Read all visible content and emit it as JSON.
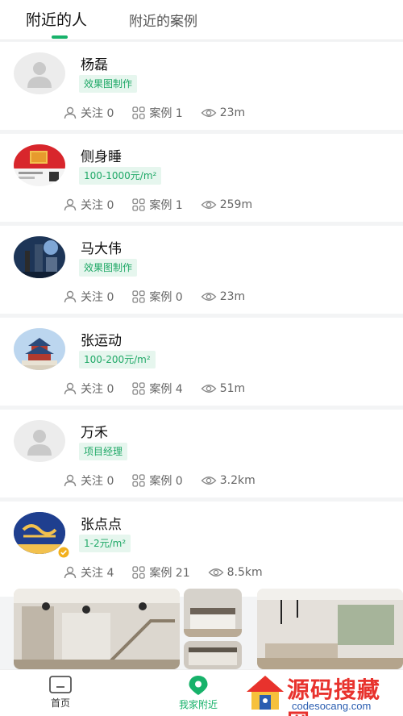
{
  "tabs": [
    {
      "label": "附近的人",
      "active": true
    },
    {
      "label": "附近的案例",
      "active": false
    }
  ],
  "icons": {
    "follow": "person-outline-icon",
    "cases": "grid-icon",
    "distance": "eye-icon"
  },
  "people": [
    {
      "name": "杨磊",
      "tag": "效果图制作",
      "follow": "关注 0",
      "cases": "案例 1",
      "distance": "23m"
    },
    {
      "name": "侧身睡",
      "tag": "100-1000元/m²",
      "follow": "关注 0",
      "cases": "案例 1",
      "distance": "259m"
    },
    {
      "name": "马大伟",
      "tag": "效果图制作",
      "follow": "关注 0",
      "cases": "案例 0",
      "distance": "23m"
    },
    {
      "name": "张运动",
      "tag": "100-200元/m²",
      "follow": "关注 0",
      "cases": "案例 4",
      "distance": "51m"
    },
    {
      "name": "万禾",
      "tag": "项目经理",
      "follow": "关注 0",
      "cases": "案例 0",
      "distance": "3.2km"
    },
    {
      "name": "张点点",
      "tag": "1-2元/m²",
      "follow": "关注 4",
      "cases": "案例 21",
      "distance": "8.5km"
    }
  ],
  "bottom_nav": [
    {
      "label": "首页",
      "active": false
    },
    {
      "label": "我家附近",
      "active": true
    }
  ],
  "watermark": {
    "title": "源码搜藏网",
    "subtitle": "codesocang.com"
  },
  "colors": {
    "accent": "#17b26a",
    "tag_bg": "#e6f6ee",
    "watermark_red": "#e8322d"
  }
}
